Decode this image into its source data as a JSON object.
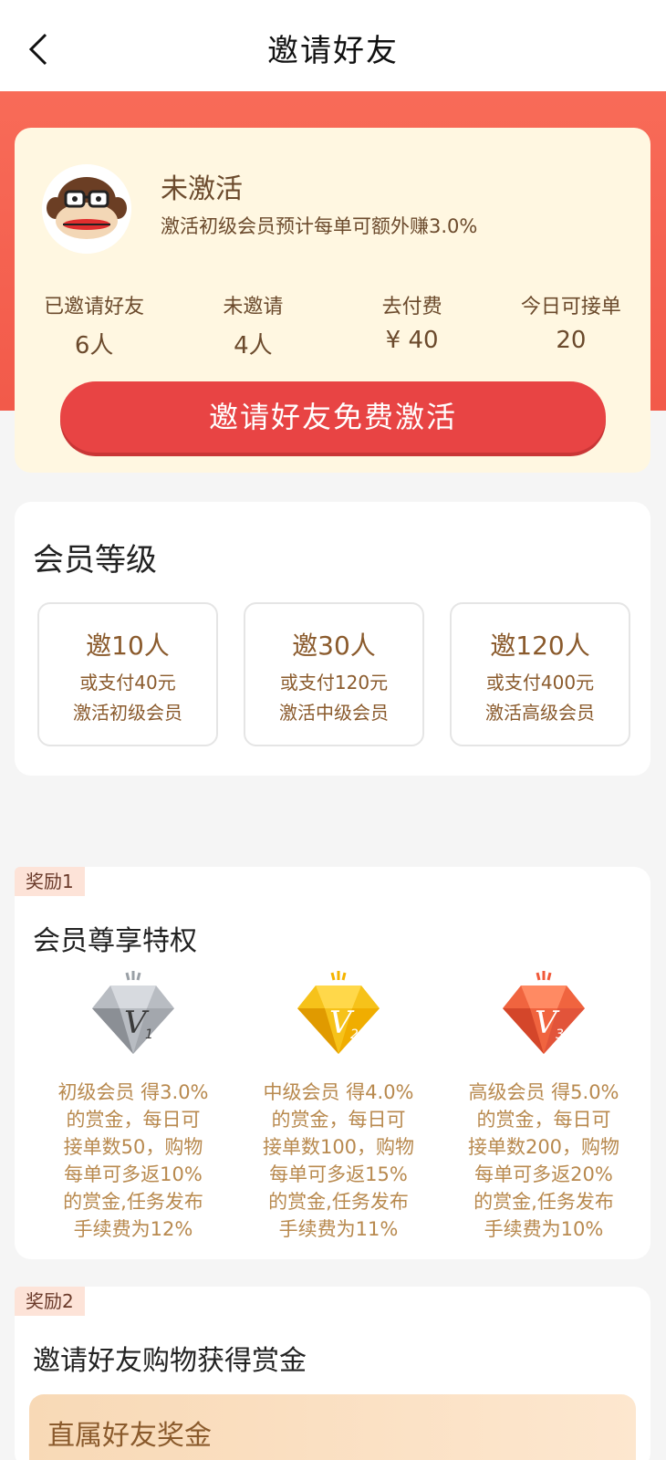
{
  "header": {
    "title": "邀请好友"
  },
  "status": {
    "title": "未激活",
    "description": "激活初级会员预计每单可额外赚3.0%",
    "stats": [
      {
        "label": "已邀请好友",
        "value": "6人"
      },
      {
        "label": "未邀请",
        "value": "4人"
      },
      {
        "label": "去付费",
        "value": "¥ 40"
      },
      {
        "label": "今日可接单",
        "value": "20"
      }
    ],
    "invite_button": "邀请好友免费激活"
  },
  "levels": {
    "title": "会员等级",
    "tiers": [
      {
        "main": "邀10人",
        "sub": "或支付40元",
        "sub2": "激活初级会员"
      },
      {
        "main": "邀30人",
        "sub": "或支付120元",
        "sub2": "激活中级会员"
      },
      {
        "main": "邀120人",
        "sub": "或支付400元",
        "sub2": "激活高级会员"
      }
    ]
  },
  "reward1": {
    "tag": "奖励1",
    "title": "会员尊享特权",
    "privileges": [
      {
        "lines": [
          "初级会员 得3.0%",
          "的赏金，每日可",
          "接单数50，购物",
          "每单可多返10%",
          "的赏金,任务发布",
          "手续费为12%"
        ],
        "color": "#9aa0a6"
      },
      {
        "lines": [
          "中级会员 得4.0%",
          "的赏金，每日可",
          "接单数100，购物",
          "每单可多返15%",
          "的赏金,任务发布",
          "手续费为11%"
        ],
        "color": "#f5b400"
      },
      {
        "lines": [
          "高级会员 得5.0%",
          "的赏金，每日可",
          "接单数200，购物",
          "每单可多返20%",
          "的赏金,任务发布",
          "手续费为10%"
        ],
        "color": "#f05a3a"
      }
    ]
  },
  "reward2": {
    "tag": "奖励2",
    "title": "邀请好友购物获得赏金",
    "bonus_title": "直属好友奖金"
  }
}
